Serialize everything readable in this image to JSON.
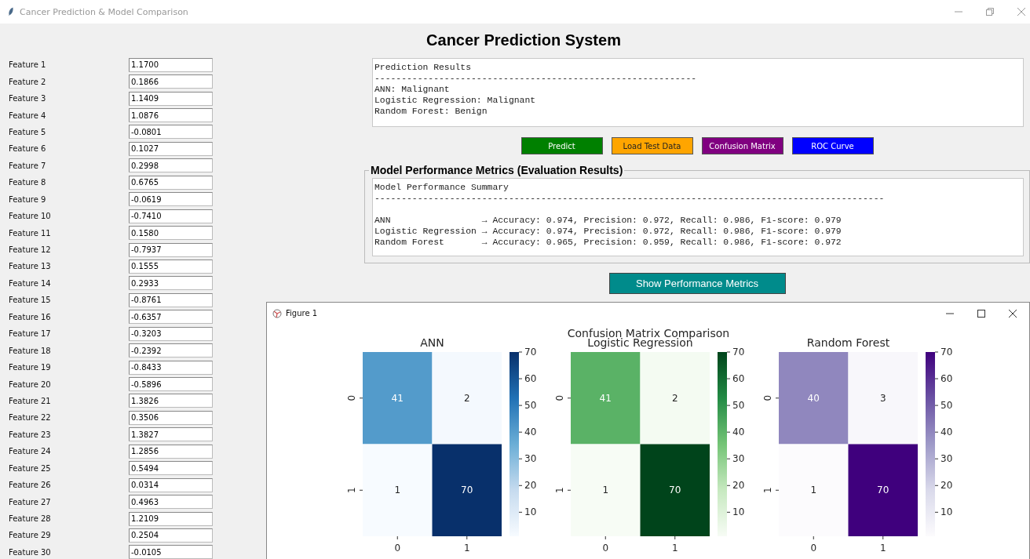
{
  "window": {
    "title": "Cancer Prediction & Model Comparison"
  },
  "heading": "Cancer Prediction System",
  "features": [
    {
      "label": "Feature 1",
      "value": "1.1700"
    },
    {
      "label": "Feature 2",
      "value": "0.1866"
    },
    {
      "label": "Feature 3",
      "value": "1.1409"
    },
    {
      "label": "Feature 4",
      "value": "1.0876"
    },
    {
      "label": "Feature 5",
      "value": "-0.0801"
    },
    {
      "label": "Feature 6",
      "value": "0.1027"
    },
    {
      "label": "Feature 7",
      "value": "0.2998"
    },
    {
      "label": "Feature 8",
      "value": "0.6765"
    },
    {
      "label": "Feature 9",
      "value": "-0.0619"
    },
    {
      "label": "Feature 10",
      "value": "-0.7410"
    },
    {
      "label": "Feature 11",
      "value": "0.1580"
    },
    {
      "label": "Feature 12",
      "value": "-0.7937"
    },
    {
      "label": "Feature 13",
      "value": "0.1555"
    },
    {
      "label": "Feature 14",
      "value": "0.2933"
    },
    {
      "label": "Feature 15",
      "value": "-0.8761"
    },
    {
      "label": "Feature 16",
      "value": "-0.6357"
    },
    {
      "label": "Feature 17",
      "value": "-0.3203"
    },
    {
      "label": "Feature 18",
      "value": "-0.2392"
    },
    {
      "label": "Feature 19",
      "value": "-0.8433"
    },
    {
      "label": "Feature 20",
      "value": "-0.5896"
    },
    {
      "label": "Feature 21",
      "value": "1.3826"
    },
    {
      "label": "Feature 22",
      "value": "0.3506"
    },
    {
      "label": "Feature 23",
      "value": "1.3827"
    },
    {
      "label": "Feature 24",
      "value": "1.2856"
    },
    {
      "label": "Feature 25",
      "value": "0.5494"
    },
    {
      "label": "Feature 26",
      "value": "0.0314"
    },
    {
      "label": "Feature 27",
      "value": "0.4963"
    },
    {
      "label": "Feature 28",
      "value": "1.2109"
    },
    {
      "label": "Feature 29",
      "value": "0.2504"
    },
    {
      "label": "Feature 30",
      "value": "-0.0105"
    }
  ],
  "prediction_output": {
    "lines": [
      "Prediction Results",
      "------------------------------------------------------------",
      "ANN: Malignant",
      "Logistic Regression: Malignant",
      "Random Forest: Benign"
    ]
  },
  "buttons": [
    {
      "label": "Predict",
      "color": "#008000"
    },
    {
      "label": "Load Test Data",
      "color": "#ffa500"
    },
    {
      "label": "Confusion Matrix",
      "color": "#800080"
    },
    {
      "label": "ROC Curve",
      "color": "#0000ff"
    }
  ],
  "metrics_frame": {
    "title": "Model Performance Metrics (Evaluation Results)",
    "heading_lines": [
      "Model Performance Summary",
      "-----------------------------------------------------------------------------------------------"
    ],
    "rows": [
      "ANN                 → Accuracy: 0.974, Precision: 0.972, Recall: 0.986, F1-score: 0.979",
      "Logistic Regression → Accuracy: 0.974, Precision: 0.972, Recall: 0.986, F1-score: 0.979",
      "Random Forest       → Accuracy: 0.965, Precision: 0.959, Recall: 0.986, F1-score: 0.972"
    ]
  },
  "show_metrics_button": {
    "label": "Show Performance Metrics"
  },
  "figure_window": {
    "title": "Figure 1",
    "suptitle": "Confusion Matrix Comparison",
    "panels": [
      {
        "title": "ANN",
        "kind": "blues",
        "cells": [
          [
            "41",
            "2"
          ],
          [
            "1",
            "70"
          ]
        ],
        "x_labels": [
          "0",
          "1"
        ],
        "y_labels": [
          "0",
          "1"
        ],
        "colorbar_ticks": [
          "70",
          "60",
          "50",
          "40",
          "30",
          "20",
          "10"
        ]
      },
      {
        "title": "Logistic Regression",
        "kind": "greens",
        "cells": [
          [
            "41",
            "2"
          ],
          [
            "1",
            "70"
          ]
        ],
        "x_labels": [
          "0",
          "1"
        ],
        "y_labels": [
          "0",
          "1"
        ],
        "colorbar_ticks": [
          "70",
          "60",
          "50",
          "40",
          "30",
          "20",
          "10"
        ]
      },
      {
        "title": "Random Forest",
        "kind": "purples",
        "cells": [
          [
            "40",
            "3"
          ],
          [
            "1",
            "70"
          ]
        ],
        "x_labels": [
          "0",
          "1"
        ],
        "y_labels": [
          "0",
          "1"
        ],
        "colorbar_ticks": [
          "70",
          "60",
          "50",
          "40",
          "30",
          "20",
          "10"
        ]
      }
    ]
  }
}
